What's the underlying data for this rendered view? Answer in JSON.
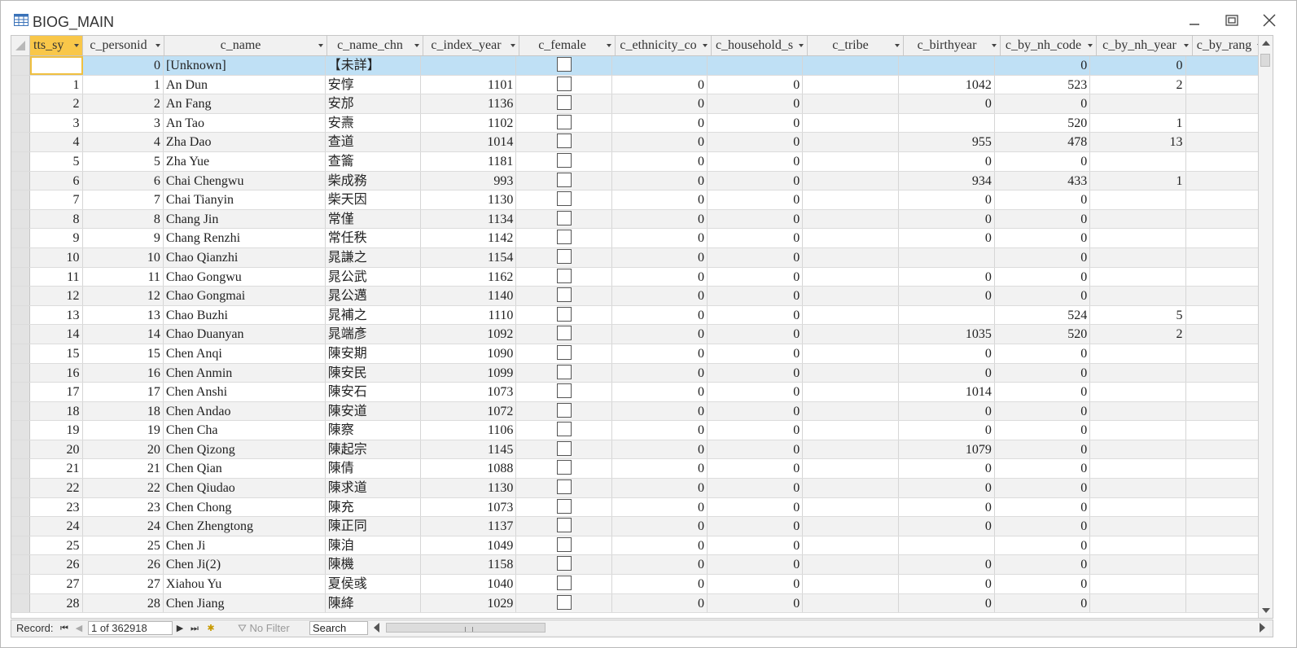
{
  "window": {
    "title": "BIOG_MAIN",
    "minimize_label": "Minimize",
    "maximize_label": "Maximize",
    "close_label": "Close"
  },
  "columns": [
    {
      "label": "tts_sy",
      "width": 65,
      "align": "num",
      "selected": true
    },
    {
      "label": "c_personid",
      "width": 100,
      "align": "num"
    },
    {
      "label": "c_name",
      "width": 200,
      "align": "text"
    },
    {
      "label": "c_name_chn",
      "width": 118,
      "align": "text"
    },
    {
      "label": "c_index_year",
      "width": 118,
      "align": "num"
    },
    {
      "label": "c_female",
      "width": 118,
      "align": "check"
    },
    {
      "label": "c_ethnicity_co",
      "width": 118,
      "align": "num"
    },
    {
      "label": "c_household_s",
      "width": 118,
      "align": "num"
    },
    {
      "label": "c_tribe",
      "width": 118,
      "align": "text"
    },
    {
      "label": "c_birthyear",
      "width": 119,
      "align": "num"
    },
    {
      "label": "c_by_nh_code",
      "width": 118,
      "align": "num"
    },
    {
      "label": "c_by_nh_year",
      "width": 118,
      "align": "num"
    },
    {
      "label": "c_by_rang",
      "width": 90,
      "align": "num"
    }
  ],
  "rows": [
    [
      "",
      "0",
      "[Unknown]",
      "【未詳】",
      "",
      "",
      "",
      "",
      "",
      "",
      "0",
      "0",
      ""
    ],
    [
      "1",
      "1",
      "An Dun",
      "安惇",
      "1101",
      "",
      "0",
      "0",
      "",
      "1042",
      "523",
      "2",
      ""
    ],
    [
      "2",
      "2",
      "An Fang",
      "安邡",
      "1136",
      "",
      "0",
      "0",
      "",
      "0",
      "0",
      "",
      ""
    ],
    [
      "3",
      "3",
      "An Tao",
      "安燾",
      "1102",
      "",
      "0",
      "0",
      "",
      "",
      "520",
      "1",
      ""
    ],
    [
      "4",
      "4",
      "Zha Dao",
      "查道",
      "1014",
      "",
      "0",
      "0",
      "",
      "955",
      "478",
      "13",
      ""
    ],
    [
      "5",
      "5",
      "Zha Yue",
      "查籥",
      "1181",
      "",
      "0",
      "0",
      "",
      "0",
      "0",
      "",
      ""
    ],
    [
      "6",
      "6",
      "Chai Chengwu",
      "柴成務",
      "993",
      "",
      "0",
      "0",
      "",
      "934",
      "433",
      "1",
      ""
    ],
    [
      "7",
      "7",
      "Chai Tianyin",
      "柴天因",
      "1130",
      "",
      "0",
      "0",
      "",
      "0",
      "0",
      "",
      ""
    ],
    [
      "8",
      "8",
      "Chang Jin",
      "常僅",
      "1134",
      "",
      "0",
      "0",
      "",
      "0",
      "0",
      "",
      ""
    ],
    [
      "9",
      "9",
      "Chang Renzhi",
      "常任秩",
      "1142",
      "",
      "0",
      "0",
      "",
      "0",
      "0",
      "",
      ""
    ],
    [
      "10",
      "10",
      "Chao Qianzhi",
      "晁謙之",
      "1154",
      "",
      "0",
      "0",
      "",
      "",
      "0",
      "",
      ""
    ],
    [
      "11",
      "11",
      "Chao Gongwu",
      "晁公武",
      "1162",
      "",
      "0",
      "0",
      "",
      "0",
      "0",
      "",
      ""
    ],
    [
      "12",
      "12",
      "Chao Gongmai",
      "晁公邁",
      "1140",
      "",
      "0",
      "0",
      "",
      "0",
      "0",
      "",
      ""
    ],
    [
      "13",
      "13",
      "Chao Buzhi",
      "晁補之",
      "1110",
      "",
      "0",
      "0",
      "",
      "",
      "524",
      "5",
      ""
    ],
    [
      "14",
      "14",
      "Chao Duanyan",
      "晁端彥",
      "1092",
      "",
      "0",
      "0",
      "",
      "1035",
      "520",
      "2",
      ""
    ],
    [
      "15",
      "15",
      "Chen Anqi",
      "陳安期",
      "1090",
      "",
      "0",
      "0",
      "",
      "0",
      "0",
      "",
      ""
    ],
    [
      "16",
      "16",
      "Chen Anmin",
      "陳安民",
      "1099",
      "",
      "0",
      "0",
      "",
      "0",
      "0",
      "",
      ""
    ],
    [
      "17",
      "17",
      "Chen Anshi",
      "陳安石",
      "1073",
      "",
      "0",
      "0",
      "",
      "1014",
      "0",
      "",
      ""
    ],
    [
      "18",
      "18",
      "Chen Andao",
      "陳安道",
      "1072",
      "",
      "0",
      "0",
      "",
      "0",
      "0",
      "",
      ""
    ],
    [
      "19",
      "19",
      "Chen Cha",
      "陳察",
      "1106",
      "",
      "0",
      "0",
      "",
      "0",
      "0",
      "",
      ""
    ],
    [
      "20",
      "20",
      "Chen Qizong",
      "陳起宗",
      "1145",
      "",
      "0",
      "0",
      "",
      "1079",
      "0",
      "",
      ""
    ],
    [
      "21",
      "21",
      "Chen Qian",
      "陳倩",
      "1088",
      "",
      "0",
      "0",
      "",
      "0",
      "0",
      "",
      ""
    ],
    [
      "22",
      "22",
      "Chen Qiudao",
      "陳求道",
      "1130",
      "",
      "0",
      "0",
      "",
      "0",
      "0",
      "",
      ""
    ],
    [
      "23",
      "23",
      "Chen Chong",
      "陳充",
      "1073",
      "",
      "0",
      "0",
      "",
      "0",
      "0",
      "",
      ""
    ],
    [
      "24",
      "24",
      "Chen Zhengtong",
      "陳正同",
      "1137",
      "",
      "0",
      "0",
      "",
      "0",
      "0",
      "",
      ""
    ],
    [
      "25",
      "25",
      "Chen Ji",
      "陳洎",
      "1049",
      "",
      "0",
      "0",
      "",
      "",
      "0",
      "",
      ""
    ],
    [
      "26",
      "26",
      "Chen Ji(2)",
      "陳機",
      "1158",
      "",
      "0",
      "0",
      "",
      "0",
      "0",
      "",
      ""
    ],
    [
      "27",
      "27",
      "Xiahou Yu",
      "夏侯彧",
      "1040",
      "",
      "0",
      "0",
      "",
      "0",
      "0",
      "",
      ""
    ],
    [
      "28",
      "28",
      "Chen Jiang",
      "陳絳",
      "1029",
      "",
      "0",
      "0",
      "",
      "0",
      "0",
      "",
      ""
    ]
  ],
  "navbar": {
    "record_label": "Record:",
    "record_value": "1 of 362918",
    "filter_label": "No Filter",
    "search_placeholder": "Search"
  },
  "colors": {
    "selected_header": "#f9c749",
    "current_row": "#bfe0f5",
    "alt_row": "#f2f2f2"
  }
}
